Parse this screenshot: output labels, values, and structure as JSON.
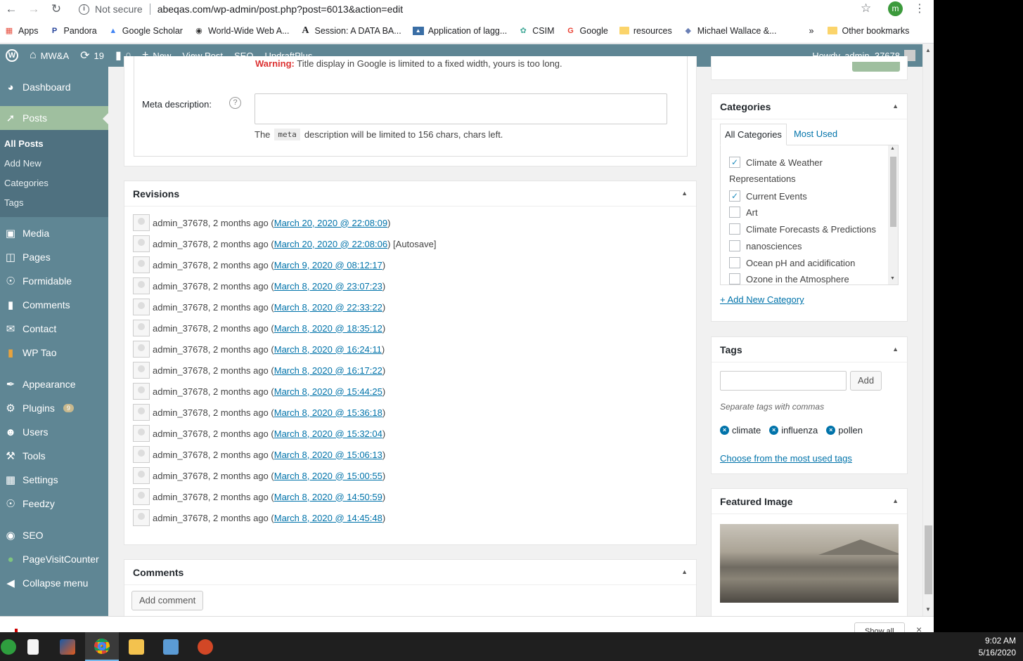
{
  "browser": {
    "security_label": "Not secure",
    "url": "abeqas.com/wp-admin/post.php?post=6013&action=edit",
    "profile_initial": "m",
    "bookmarks": [
      {
        "label": "Apps",
        "icon": "apps-grid-icon"
      },
      {
        "label": "Pandora",
        "icon": "pandora-icon"
      },
      {
        "label": "Google Scholar",
        "icon": "scholar-icon"
      },
      {
        "label": "World-Wide Web A...",
        "icon": "globe-icon"
      },
      {
        "label": "Session: A DATA BA...",
        "icon": "academia-icon"
      },
      {
        "label": "Application of lagg...",
        "icon": "doc-icon"
      },
      {
        "label": "CSIM",
        "icon": "csim-icon"
      },
      {
        "label": "Google",
        "icon": "google-icon"
      },
      {
        "label": "resources",
        "icon": "folder-icon"
      },
      {
        "label": "Michael Wallace &...",
        "icon": "site-icon"
      }
    ],
    "overflow": "»",
    "other_bookmarks": "Other bookmarks"
  },
  "adminbar": {
    "site_name": "MW&A",
    "updates_count": "19",
    "comments_count": "0",
    "new_label": "New",
    "view_post": "View Post",
    "seo": "SEO",
    "updraft": "UpdraftPlus",
    "howdy": "Howdy, admin_37678"
  },
  "sidebar": {
    "items_top": [
      {
        "label": "Dashboard",
        "icon": "dashboard-icon"
      },
      {
        "label": "Posts",
        "icon": "pin-icon"
      }
    ],
    "submenu": [
      "All Posts",
      "Add New",
      "Categories",
      "Tags"
    ],
    "items": [
      {
        "label": "Media",
        "icon": "media-icon"
      },
      {
        "label": "Pages",
        "icon": "pages-icon"
      },
      {
        "label": "Formidable",
        "icon": "formidable-icon"
      },
      {
        "label": "Comments",
        "icon": "comment-icon"
      },
      {
        "label": "Contact",
        "icon": "mail-icon"
      },
      {
        "label": "WP Tao",
        "icon": "chart-icon"
      },
      {
        "label": "Appearance",
        "icon": "brush-icon"
      },
      {
        "label": "Plugins",
        "icon": "plug-icon",
        "badge": "9"
      },
      {
        "label": "Users",
        "icon": "user-icon"
      },
      {
        "label": "Tools",
        "icon": "wrench-icon"
      },
      {
        "label": "Settings",
        "icon": "settings-icon"
      },
      {
        "label": "Feedzy",
        "icon": "feed-icon"
      },
      {
        "label": "SEO",
        "icon": "seo-icon"
      },
      {
        "label": "PageVisitCounter",
        "icon": "globe-icon"
      },
      {
        "label": "Collapse menu",
        "icon": "collapse-icon"
      }
    ]
  },
  "meta": {
    "warning_bold": "Warning:",
    "warning_text": "Title display in Google is limited to a fixed width, yours is too long.",
    "label": "Meta description:",
    "help": "?",
    "note_pre": "The",
    "note_code": "meta",
    "note_post": "description will be limited to 156 chars, chars left."
  },
  "revisions": {
    "title": "Revisions",
    "entries": [
      {
        "author": "admin_37678, 2 months ago (",
        "date": "March 20, 2020 @ 22:08:09",
        "suffix": ")"
      },
      {
        "author": "admin_37678, 2 months ago (",
        "date": "March 20, 2020 @ 22:08:06",
        "suffix": ") [Autosave]"
      },
      {
        "author": "admin_37678, 2 months ago (",
        "date": "March 9, 2020 @ 08:12:17",
        "suffix": ")"
      },
      {
        "author": "admin_37678, 2 months ago (",
        "date": "March 8, 2020 @ 23:07:23",
        "suffix": ")"
      },
      {
        "author": "admin_37678, 2 months ago (",
        "date": "March 8, 2020 @ 22:33:22",
        "suffix": ")"
      },
      {
        "author": "admin_37678, 2 months ago (",
        "date": "March 8, 2020 @ 18:35:12",
        "suffix": ")"
      },
      {
        "author": "admin_37678, 2 months ago (",
        "date": "March 8, 2020 @ 16:24:11",
        "suffix": ")"
      },
      {
        "author": "admin_37678, 2 months ago (",
        "date": "March 8, 2020 @ 16:17:22",
        "suffix": ")"
      },
      {
        "author": "admin_37678, 2 months ago (",
        "date": "March 8, 2020 @ 15:44:25",
        "suffix": ")"
      },
      {
        "author": "admin_37678, 2 months ago (",
        "date": "March 8, 2020 @ 15:36:18",
        "suffix": ")"
      },
      {
        "author": "admin_37678, 2 months ago (",
        "date": "March 8, 2020 @ 15:32:04",
        "suffix": ")"
      },
      {
        "author": "admin_37678, 2 months ago (",
        "date": "March 8, 2020 @ 15:06:13",
        "suffix": ")"
      },
      {
        "author": "admin_37678, 2 months ago (",
        "date": "March 8, 2020 @ 15:00:55",
        "suffix": ")"
      },
      {
        "author": "admin_37678, 2 months ago (",
        "date": "March 8, 2020 @ 14:50:59",
        "suffix": ")"
      },
      {
        "author": "admin_37678, 2 months ago (",
        "date": "March 8, 2020 @ 14:45:48",
        "suffix": ")"
      }
    ]
  },
  "comments_box": {
    "title": "Comments",
    "add_label": "Add comment"
  },
  "categories": {
    "title": "Categories",
    "tab_all": "All Categories",
    "tab_most": "Most Used",
    "items": [
      {
        "label": "Climate & Weather",
        "checked": true
      },
      {
        "label": "Representations",
        "checked": null
      },
      {
        "label": "Current Events",
        "checked": true
      },
      {
        "label": "Art",
        "checked": false
      },
      {
        "label": "Climate Forecasts & Predictions",
        "checked": false
      },
      {
        "label": "nanosciences",
        "checked": false
      },
      {
        "label": "Ocean pH and acidification",
        "checked": false
      },
      {
        "label": "Ozone in the Atmosphere",
        "checked": false
      }
    ],
    "add_new": "+ Add New Category"
  },
  "tags": {
    "title": "Tags",
    "add_label": "Add",
    "help": "Separate tags with commas",
    "items": [
      "climate",
      "influenza",
      "pollen"
    ],
    "choose": "Choose from the most used tags"
  },
  "featured": {
    "title": "Featured Image"
  },
  "downloads": {
    "show_all": "Show all"
  },
  "taskbar": {
    "time": "9:02 AM",
    "date": "5/16/2020"
  }
}
